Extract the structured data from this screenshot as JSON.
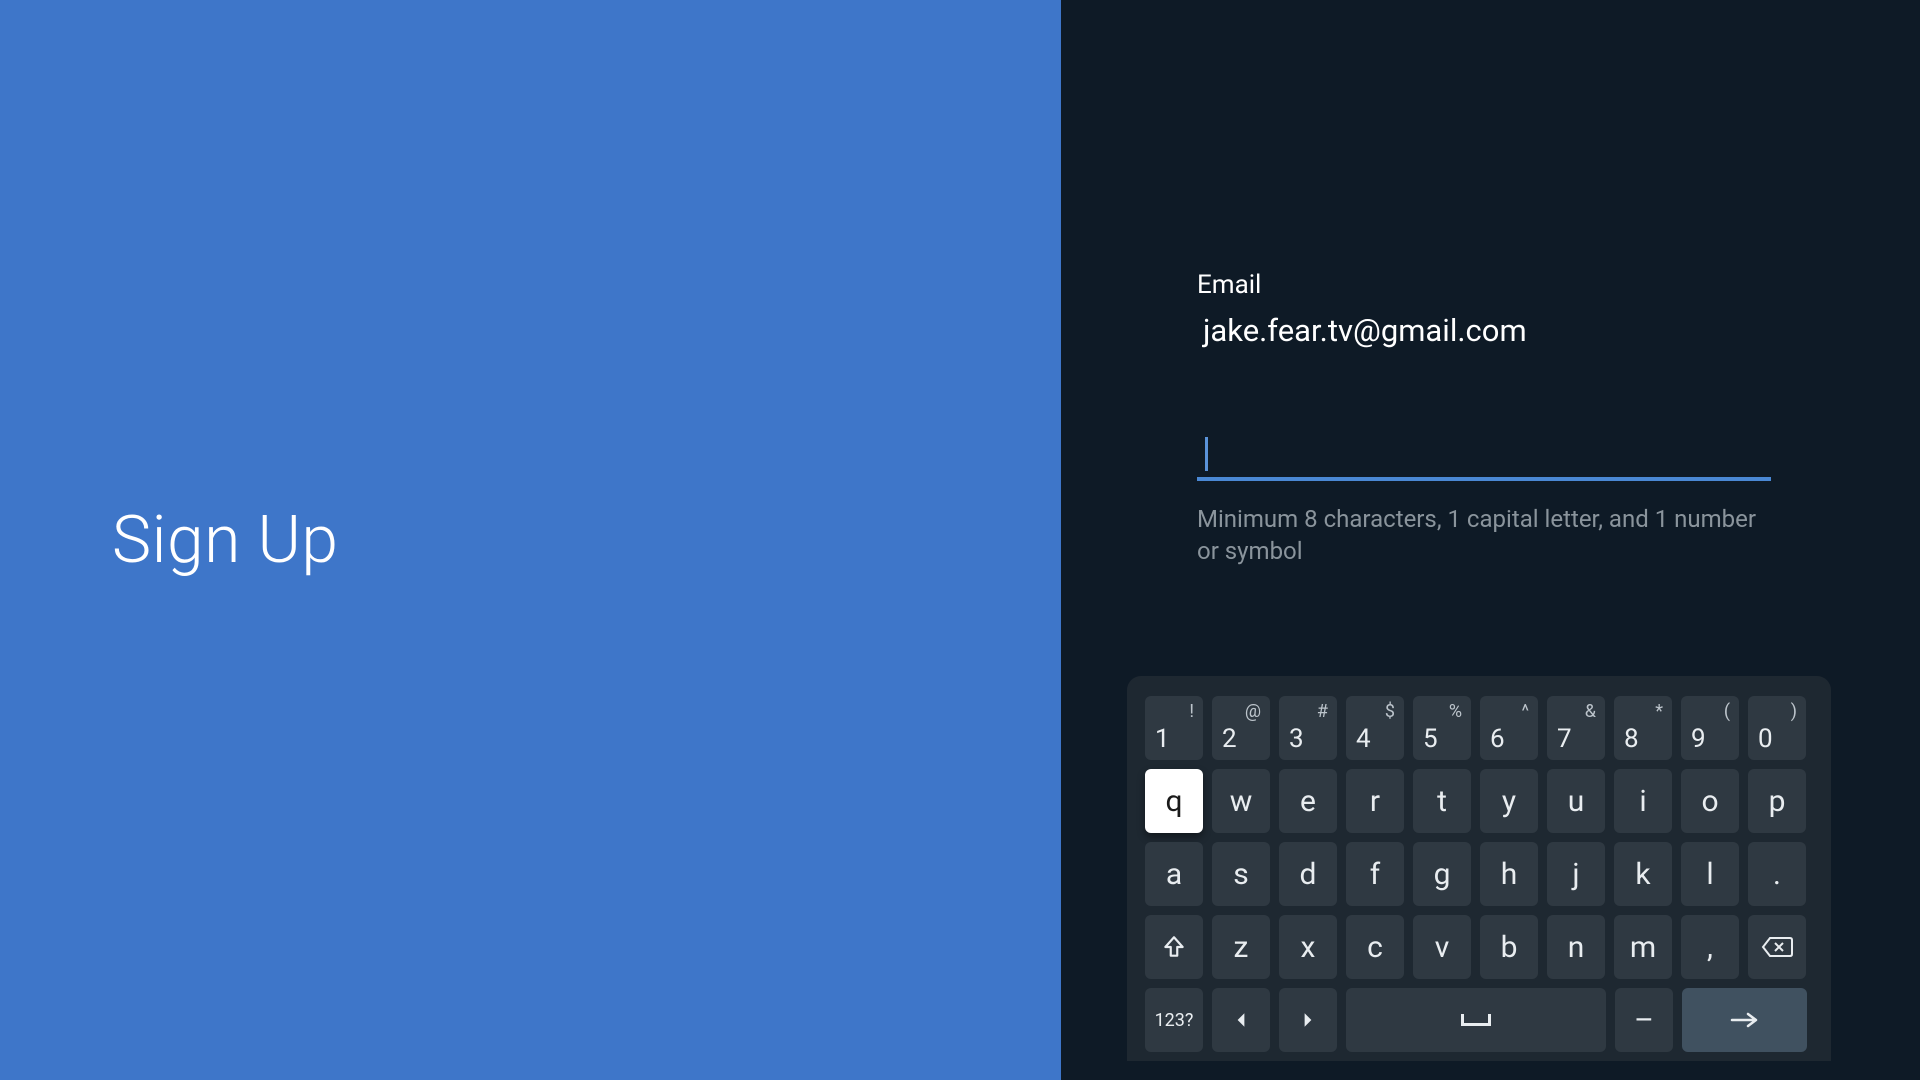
{
  "left": {
    "title": "Sign Up"
  },
  "form": {
    "email_label": "Email",
    "email_value": "jake.fear.tv@gmail.com",
    "password_value": "",
    "password_hint": "Minimum 8 characters, 1 capital letter, and 1 number or symbol"
  },
  "keyboard": {
    "row1": [
      {
        "main": "1",
        "sym": "!"
      },
      {
        "main": "2",
        "sym": "@"
      },
      {
        "main": "3",
        "sym": "#"
      },
      {
        "main": "4",
        "sym": "$"
      },
      {
        "main": "5",
        "sym": "%"
      },
      {
        "main": "6",
        "sym": "^"
      },
      {
        "main": "7",
        "sym": "&"
      },
      {
        "main": "8",
        "sym": "*"
      },
      {
        "main": "9",
        "sym": "("
      },
      {
        "main": "0",
        "sym": ")"
      }
    ],
    "row2": [
      "q",
      "w",
      "e",
      "r",
      "t",
      "y",
      "u",
      "i",
      "o",
      "p"
    ],
    "row3": [
      "a",
      "s",
      "d",
      "f",
      "g",
      "h",
      "j",
      "k",
      "l",
      "."
    ],
    "row4_letters": [
      "z",
      "x",
      "c",
      "v",
      "b",
      "n",
      "m",
      ","
    ],
    "mode_label": "123?",
    "dash_label": "–",
    "highlighted_key": "q"
  }
}
